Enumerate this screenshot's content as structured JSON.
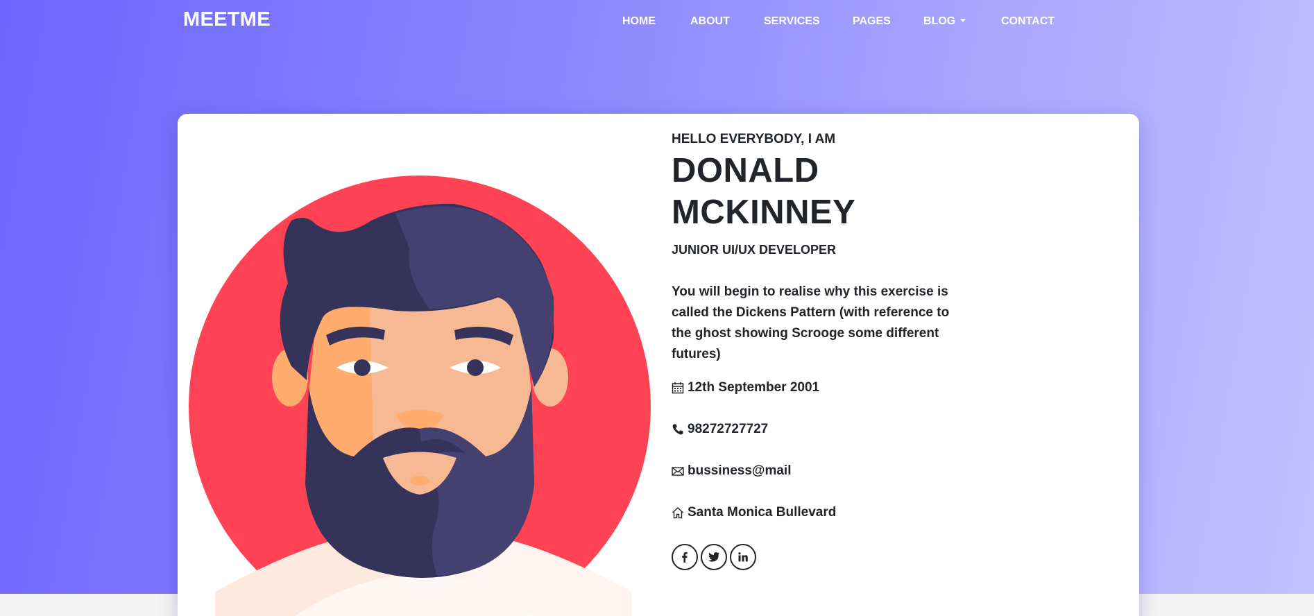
{
  "nav": {
    "brand": "MEETME",
    "items": [
      {
        "label": "HOME"
      },
      {
        "label": "ABOUT"
      },
      {
        "label": "SERVICES"
      },
      {
        "label": "PAGES"
      },
      {
        "label": "BLOG"
      },
      {
        "label": "CONTACT"
      }
    ]
  },
  "profile": {
    "greeting": "HELLO EVERYBODY, I AM",
    "name": "DONALD MCKINNEY",
    "role": "JUNIOR UI/UX DEVELOPER",
    "bio": "You will begin to realise why this exercise is called the Dickens Pattern (with reference to the ghost showing Scrooge some different futures)",
    "details": {
      "birthday": {
        "icon": "calendar-icon",
        "text": "12th September 2001"
      },
      "phone": {
        "icon": "phone-icon",
        "text": "98272727727"
      },
      "email": {
        "icon": "envelope-icon",
        "text": "bussiness@mail"
      },
      "address": {
        "icon": "home-icon",
        "text": "Santa Monica Bullevard"
      }
    },
    "socials": [
      {
        "icon": "facebook-icon"
      },
      {
        "icon": "twitter-icon"
      },
      {
        "icon": "linkedin-icon"
      }
    ]
  },
  "colors": {
    "gradient_start": "#6b66ff",
    "gradient_end": "#c3c0ff",
    "avatar_circle": "#ff4254",
    "beard": "#3d3b6b",
    "skin": "#f7b994",
    "text": "#212529"
  }
}
